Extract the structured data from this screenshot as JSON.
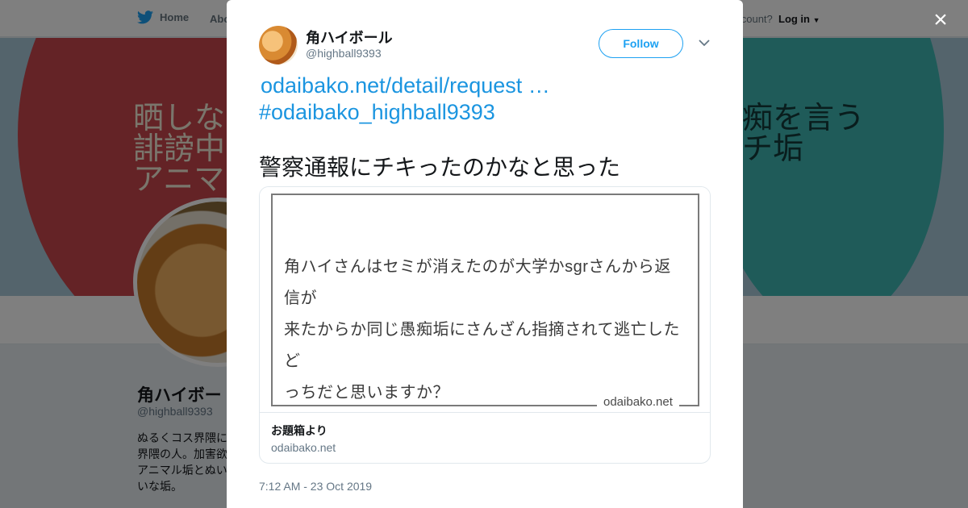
{
  "background": {
    "nav": {
      "home_label": "Home",
      "about_label": "Abo",
      "account_question": "account?",
      "login_label": "Log in"
    },
    "banner": {
      "left_text": [
        "晒しな",
        "誹謗中",
        "アニマ"
      ],
      "right_text": [
        "痴を言う",
        "チ垢"
      ]
    },
    "profile": {
      "name": "角ハイボー",
      "handle": "@highball9393",
      "bio_lines": [
        "ぬるくコス界隈に",
        "界隈の人。加害欲",
        "アニマル垢とぬい",
        "いな垢。"
      ]
    }
  },
  "modal": {
    "close_label": "×",
    "author": {
      "name": "角ハイボール",
      "handle": "@highball9393"
    },
    "follow_label": "Follow",
    "link_line": "odaibako.net/detail/request  …",
    "hashtag": "#odaibako_highball9393",
    "text": "警察通報にチキったのかなと思った",
    "card": {
      "image_text_lines": [
        "角ハイさんはセミが消えたのが大学かsgrさんから返信が",
        "来たからか同じ愚痴垢にさんざん指摘されて逃亡したど",
        "っちだと思いますか？"
      ],
      "watermark": "odaibako.net",
      "title": "お題箱より",
      "domain": "odaibako.net"
    },
    "timestamp": "7:12 AM - 23 Oct 2019"
  },
  "colors": {
    "link": "#1b95e0",
    "follow": "#1da1f2",
    "banner_red": "#c8474c",
    "banner_teal": "#3fb6b2"
  },
  "icons": [
    "twitter-bird-icon",
    "caret-down-icon",
    "close-icon",
    "chevron-down-icon"
  ]
}
